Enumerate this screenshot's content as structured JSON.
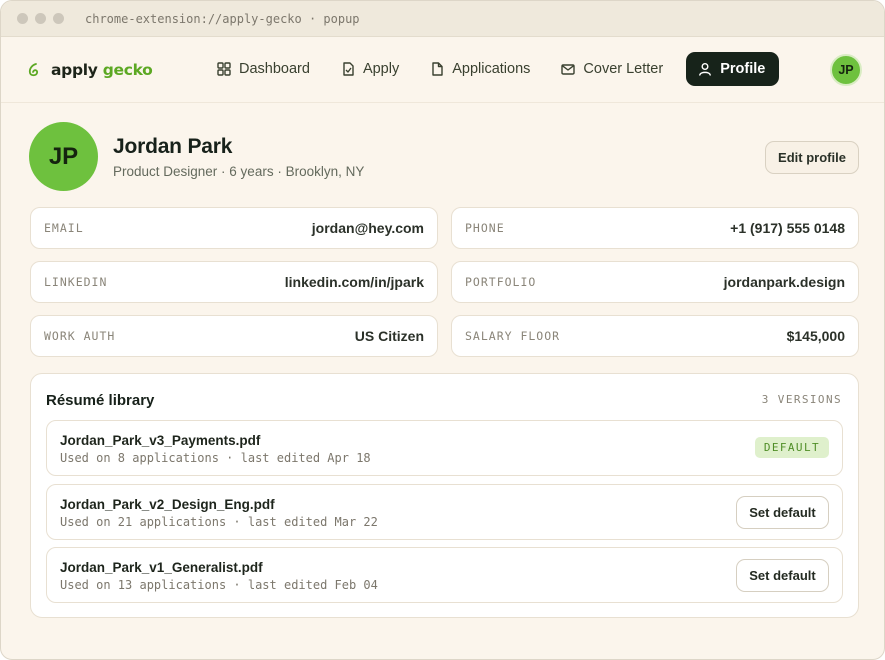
{
  "window": {
    "url": "chrome-extension://apply-gecko · popup"
  },
  "brand": {
    "apply": "apply",
    "gecko": "gecko",
    "icon": "gecko-logo-icon",
    "accent": "#5ca823"
  },
  "nav": {
    "items": [
      {
        "label": "Dashboard",
        "icon": "grid-icon"
      },
      {
        "label": "Apply",
        "icon": "document-check-icon"
      },
      {
        "label": "Applications",
        "icon": "file-icon"
      },
      {
        "label": "Cover Letter",
        "icon": "mail-icon"
      },
      {
        "label": "Profile",
        "icon": "user-icon",
        "active": true
      }
    ],
    "avatar_initials": "JP"
  },
  "profile": {
    "initials": "JP",
    "name": "Jordan Park",
    "subtitle": "Product Designer · 6 years · Brooklyn, NY",
    "edit_label": "Edit profile"
  },
  "fields": [
    {
      "label": "EMAIL",
      "value": "jordan@hey.com"
    },
    {
      "label": "PHONE",
      "value": "+1 (917) 555 0148"
    },
    {
      "label": "LINKEDIN",
      "value": "linkedin.com/in/jpark"
    },
    {
      "label": "PORTFOLIO",
      "value": "jordanpark.design"
    },
    {
      "label": "WORK AUTH",
      "value": "US Citizen"
    },
    {
      "label": "SALARY FLOOR",
      "value": "$145,000"
    }
  ],
  "library": {
    "title": "Résumé library",
    "count": "3 VERSIONS",
    "resumes": [
      {
        "name": "Jordan_Park_v3_Payments.pdf",
        "meta": "Used on 8 applications · last edited Apr 18",
        "badge": "DEFAULT"
      },
      {
        "name": "Jordan_Park_v2_Design_Eng.pdf",
        "meta": "Used on 21 applications · last edited Mar 22",
        "action": "Set default"
      },
      {
        "name": "Jordan_Park_v1_Generalist.pdf",
        "meta": "Used on 13 applications · last edited Feb 04",
        "action": "Set default"
      }
    ]
  }
}
